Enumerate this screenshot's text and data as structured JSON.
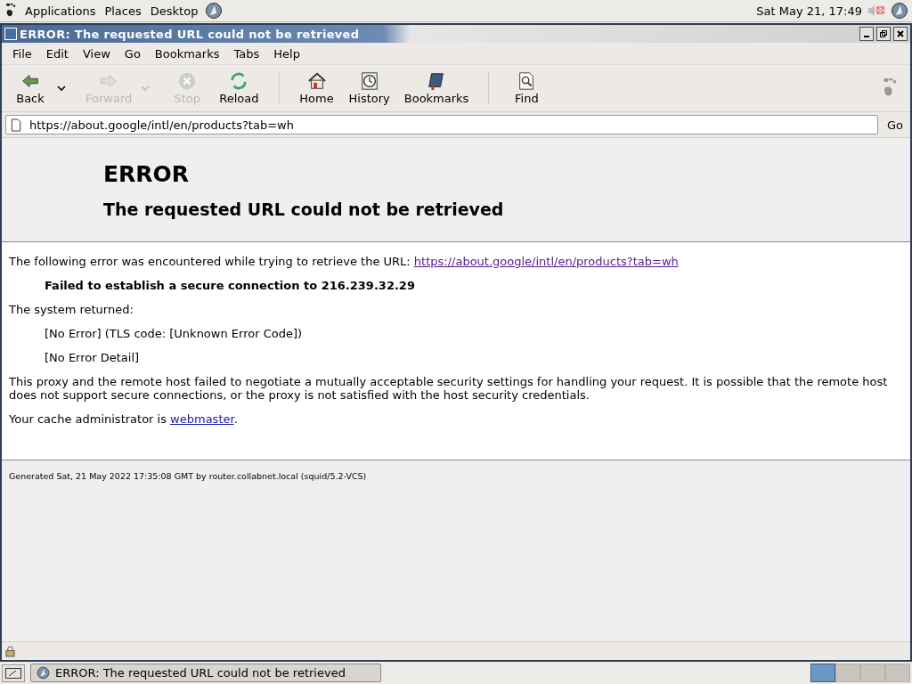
{
  "top_panel": {
    "menus": [
      "Applications",
      "Places",
      "Desktop"
    ],
    "clock": "Sat May 21, 17:49"
  },
  "window": {
    "title": "ERROR: The requested URL could not be retrieved"
  },
  "menu_bar": [
    "File",
    "Edit",
    "View",
    "Go",
    "Bookmarks",
    "Tabs",
    "Help"
  ],
  "toolbar": [
    {
      "kind": "button",
      "label": "Back",
      "disabled": false,
      "has_menu": true
    },
    {
      "kind": "button",
      "label": "Forward",
      "disabled": true,
      "has_menu": true
    },
    {
      "kind": "button",
      "label": "Stop",
      "disabled": true,
      "has_menu": false
    },
    {
      "kind": "button",
      "label": "Reload",
      "disabled": false,
      "has_menu": false
    },
    {
      "kind": "separator"
    },
    {
      "kind": "button",
      "label": "Home",
      "disabled": false,
      "has_menu": false
    },
    {
      "kind": "button",
      "label": "History",
      "disabled": false,
      "has_menu": false
    },
    {
      "kind": "button",
      "label": "Bookmarks",
      "disabled": false,
      "has_menu": false
    },
    {
      "kind": "separator"
    },
    {
      "kind": "button",
      "label": "Find",
      "disabled": false,
      "has_menu": false
    }
  ],
  "address_bar": {
    "value": "https://about.google/intl/en/products?tab=wh",
    "go": "Go"
  },
  "page": {
    "heading": "ERROR",
    "subheading": "The requested URL could not be retrieved",
    "intro": "The following error was encountered while trying to retrieve the URL: ",
    "intro_link": "https://about.google/intl/en/products?tab=wh",
    "error": "Failed to establish a secure connection to 216.239.32.29",
    "system_label": "The system returned:",
    "system_lines": [
      "[No Error] (TLS code: [Unknown Error Code])",
      "[No Error Detail]"
    ],
    "explanation": "This proxy and the remote host failed to negotiate a mutually acceptable security settings for handling your request. It is possible that the remote host does not support secure connections, or the proxy is not satisfied with the host security credentials.",
    "admin_text": "Your cache administrator is ",
    "admin_link": "webmaster",
    "admin_end": ".",
    "footer": "Generated Sat, 21 May 2022 17:35:08 GMT by router.collabnet.local (squid/5.2-VCS)"
  },
  "taskbar": {
    "window": "ERROR: The requested URL could not be retrieved",
    "workspaces": [
      {
        "selected": true
      },
      {
        "selected": false
      },
      {
        "selected": false
      },
      {
        "selected": false
      }
    ]
  }
}
